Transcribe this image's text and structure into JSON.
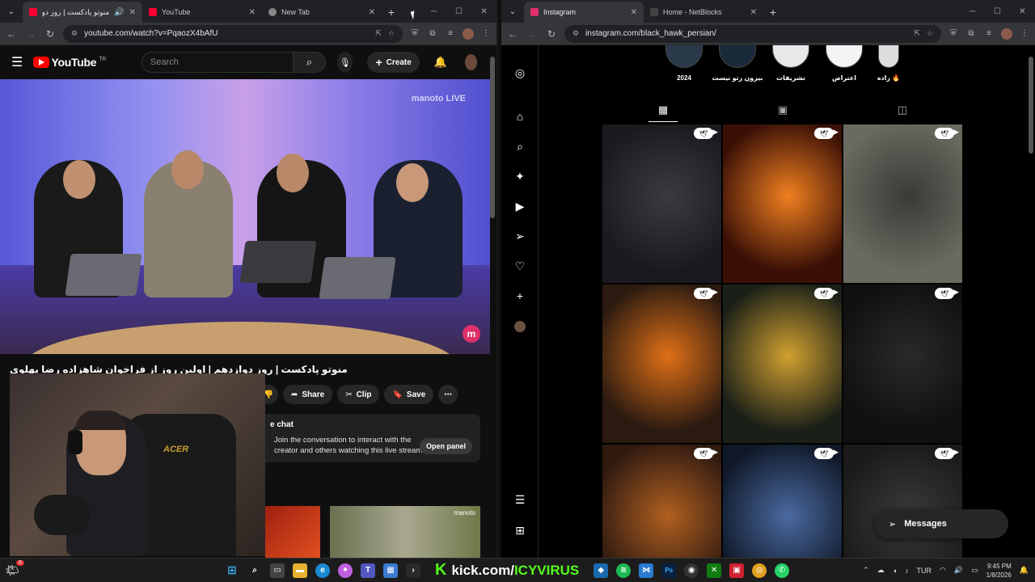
{
  "left_window": {
    "tabs": [
      {
        "title": "منوتو پادکست | روز دواز",
        "favicon_color": "#ff0033",
        "active": true
      },
      {
        "title": "YouTube",
        "favicon_color": "#ff0033",
        "active": false
      },
      {
        "title": "New Tab",
        "favicon_color": "#888888",
        "active": false
      }
    ],
    "url": "youtube.com/watch?v=PqaozX4bAfU"
  },
  "youtube": {
    "logo_text": "YouTube",
    "logo_region": "TR",
    "search_placeholder": "Search",
    "create_label": "Create",
    "video_watermark": "manoto LIVE",
    "video_badge": "m",
    "video_title": "منوتو پادکست | روز دوازدهم | اولین روز از فراخوان شاهزاده رضا پهلوی",
    "actions": {
      "share": "Share",
      "clip": "Clip",
      "save": "Save"
    },
    "chat": {
      "label": "e chat",
      "message": "Join the conversation to interact with the creator and others watching this live stream.",
      "open_panel": "Open panel"
    },
    "webcam_chair_brand": "ACER",
    "thumb2_tag": "manoto"
  },
  "right_window": {
    "tabs": [
      {
        "title": "Instagram",
        "favicon_color": "#e1306c",
        "active": true
      },
      {
        "title": "Home - NetBlocks",
        "favicon_color": "#444444",
        "active": false
      }
    ],
    "url": "instagram.com/black_hawk_persian/"
  },
  "instagram": {
    "highlights": [
      {
        "label": "2024"
      },
      {
        "label": "بیرون زتو نیست"
      },
      {
        "label": "تشریفات"
      },
      {
        "label": "اعتراض"
      },
      {
        "label": "زاده 🔥"
      }
    ],
    "messages_label": "Messages",
    "grid_colors": [
      [
        "#1a1a1e",
        "#3a3a40"
      ],
      [
        "#3a1006",
        "#f08020"
      ],
      [
        "#6a6a60",
        "#3a3a38"
      ],
      [
        "#2a1a10",
        "#e07018"
      ],
      [
        "#1a2018",
        "#d0a030"
      ],
      [
        "#101010",
        "#2a2a2a"
      ],
      [
        "#301a10",
        "#b06020"
      ],
      [
        "#101828",
        "#4a6aa0"
      ],
      [
        "#1a1a1a",
        "#3a3a3a"
      ]
    ]
  },
  "taskbar": {
    "kick_prefix": "kick.com/",
    "kick_user": "ICYVIRUS",
    "lang": "TUR",
    "time": "9:45 PM",
    "date": "1/8/2026",
    "notification_count": "6"
  }
}
